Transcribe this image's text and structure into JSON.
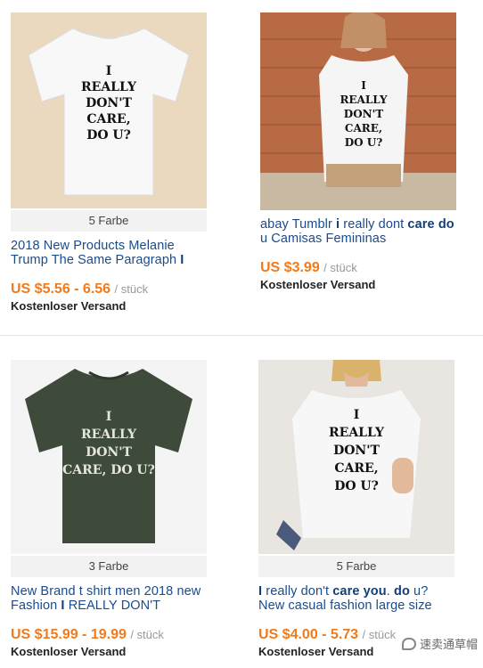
{
  "products": [
    {
      "colors": "5 Farbe",
      "title_parts": [
        {
          "t": "2018 New Products Melanie Trump The Same Paragraph ",
          "b": false
        },
        {
          "t": "I",
          "b": true
        }
      ],
      "price": "US $5.56 - 6.56",
      "unit": "/ stück",
      "shipping": "Kostenloser Versand",
      "shirt_color": "#f8f8f8",
      "background": "#ead9be",
      "print_color": "#111111",
      "print_text": [
        "I",
        "REALLY",
        "DON'T",
        "CARE,",
        "DO U?"
      ]
    },
    {
      "colors": "",
      "title_parts": [
        {
          "t": "abay Tumblr ",
          "b": false
        },
        {
          "t": "i",
          "b": true
        },
        {
          "t": " really dont ",
          "b": false
        },
        {
          "t": "care",
          "b": true
        },
        {
          "t": " ",
          "b": false
        },
        {
          "t": "do",
          "b": true
        },
        {
          "t": " u Camisas Femininas",
          "b": false
        }
      ],
      "price": "US $3.99",
      "unit": "/ stück",
      "shipping": "Kostenloser Versand",
      "shirt_color": "#f5f5f5",
      "background": "#b86a45",
      "print_color": "#111111",
      "print_text": [
        "I",
        "REALLY",
        "DON'T",
        "CARE,",
        "DO U?"
      ]
    },
    {
      "colors": "3 Farbe",
      "title_parts": [
        {
          "t": "New Brand t shirt men 2018 new Fashion ",
          "b": false
        },
        {
          "t": "I",
          "b": true
        },
        {
          "t": " REALLY DON'T",
          "b": false
        }
      ],
      "price": "US $15.99 - 19.99",
      "unit": "/ stück",
      "shipping": "Kostenloser Versand",
      "shirt_color": "#3e4a3a",
      "background": "#f4f4f4",
      "print_color": "#e6e6e0",
      "print_text": [
        "I",
        "REALLY",
        "DON'T",
        "CARE, DO U?"
      ]
    },
    {
      "colors": "5 Farbe",
      "title_parts": [
        {
          "t": "I",
          "b": true
        },
        {
          "t": " really don't ",
          "b": false
        },
        {
          "t": "care you",
          "b": true
        },
        {
          "t": ". ",
          "b": false
        },
        {
          "t": "do",
          "b": true
        },
        {
          "t": " u? New casual fashion large size",
          "b": false
        }
      ],
      "price": "US $4.00 - 5.73",
      "unit": "/ stück",
      "shipping": "Kostenloser Versand",
      "shirt_color": "#f7f7f7",
      "background": "#e9e6e2",
      "print_color": "#111111",
      "print_text": [
        "I",
        "REALLY",
        "DON'T",
        "CARE,",
        "DO U?"
      ]
    }
  ],
  "watermark": {
    "text": "速卖通草帽"
  }
}
